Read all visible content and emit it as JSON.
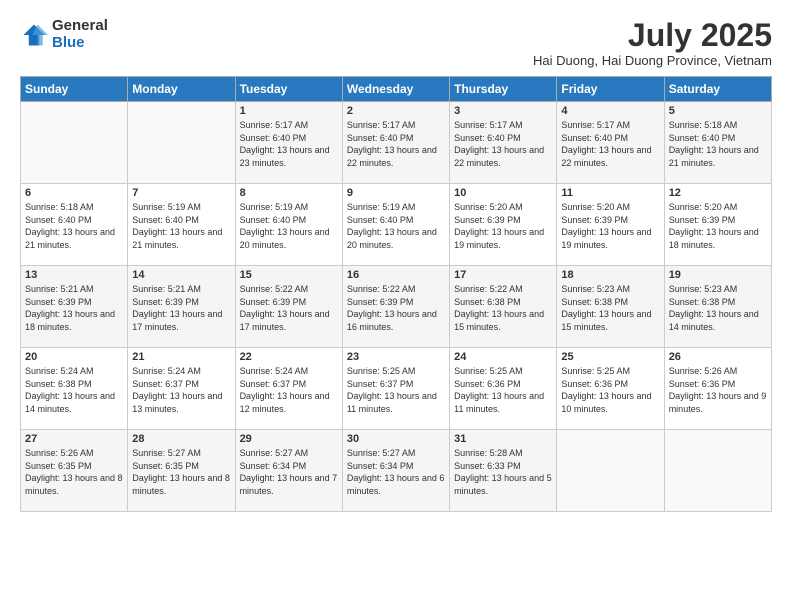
{
  "logo": {
    "general": "General",
    "blue": "Blue"
  },
  "title": {
    "month_year": "July 2025",
    "location": "Hai Duong, Hai Duong Province, Vietnam"
  },
  "days_of_week": [
    "Sunday",
    "Monday",
    "Tuesday",
    "Wednesday",
    "Thursday",
    "Friday",
    "Saturday"
  ],
  "weeks": [
    [
      {
        "day": "",
        "info": ""
      },
      {
        "day": "",
        "info": ""
      },
      {
        "day": "1",
        "info": "Sunrise: 5:17 AM\nSunset: 6:40 PM\nDaylight: 13 hours and 23 minutes."
      },
      {
        "day": "2",
        "info": "Sunrise: 5:17 AM\nSunset: 6:40 PM\nDaylight: 13 hours and 22 minutes."
      },
      {
        "day": "3",
        "info": "Sunrise: 5:17 AM\nSunset: 6:40 PM\nDaylight: 13 hours and 22 minutes."
      },
      {
        "day": "4",
        "info": "Sunrise: 5:17 AM\nSunset: 6:40 PM\nDaylight: 13 hours and 22 minutes."
      },
      {
        "day": "5",
        "info": "Sunrise: 5:18 AM\nSunset: 6:40 PM\nDaylight: 13 hours and 21 minutes."
      }
    ],
    [
      {
        "day": "6",
        "info": "Sunrise: 5:18 AM\nSunset: 6:40 PM\nDaylight: 13 hours and 21 minutes."
      },
      {
        "day": "7",
        "info": "Sunrise: 5:19 AM\nSunset: 6:40 PM\nDaylight: 13 hours and 21 minutes."
      },
      {
        "day": "8",
        "info": "Sunrise: 5:19 AM\nSunset: 6:40 PM\nDaylight: 13 hours and 20 minutes."
      },
      {
        "day": "9",
        "info": "Sunrise: 5:19 AM\nSunset: 6:40 PM\nDaylight: 13 hours and 20 minutes."
      },
      {
        "day": "10",
        "info": "Sunrise: 5:20 AM\nSunset: 6:39 PM\nDaylight: 13 hours and 19 minutes."
      },
      {
        "day": "11",
        "info": "Sunrise: 5:20 AM\nSunset: 6:39 PM\nDaylight: 13 hours and 19 minutes."
      },
      {
        "day": "12",
        "info": "Sunrise: 5:20 AM\nSunset: 6:39 PM\nDaylight: 13 hours and 18 minutes."
      }
    ],
    [
      {
        "day": "13",
        "info": "Sunrise: 5:21 AM\nSunset: 6:39 PM\nDaylight: 13 hours and 18 minutes."
      },
      {
        "day": "14",
        "info": "Sunrise: 5:21 AM\nSunset: 6:39 PM\nDaylight: 13 hours and 17 minutes."
      },
      {
        "day": "15",
        "info": "Sunrise: 5:22 AM\nSunset: 6:39 PM\nDaylight: 13 hours and 17 minutes."
      },
      {
        "day": "16",
        "info": "Sunrise: 5:22 AM\nSunset: 6:39 PM\nDaylight: 13 hours and 16 minutes."
      },
      {
        "day": "17",
        "info": "Sunrise: 5:22 AM\nSunset: 6:38 PM\nDaylight: 13 hours and 15 minutes."
      },
      {
        "day": "18",
        "info": "Sunrise: 5:23 AM\nSunset: 6:38 PM\nDaylight: 13 hours and 15 minutes."
      },
      {
        "day": "19",
        "info": "Sunrise: 5:23 AM\nSunset: 6:38 PM\nDaylight: 13 hours and 14 minutes."
      }
    ],
    [
      {
        "day": "20",
        "info": "Sunrise: 5:24 AM\nSunset: 6:38 PM\nDaylight: 13 hours and 14 minutes."
      },
      {
        "day": "21",
        "info": "Sunrise: 5:24 AM\nSunset: 6:37 PM\nDaylight: 13 hours and 13 minutes."
      },
      {
        "day": "22",
        "info": "Sunrise: 5:24 AM\nSunset: 6:37 PM\nDaylight: 13 hours and 12 minutes."
      },
      {
        "day": "23",
        "info": "Sunrise: 5:25 AM\nSunset: 6:37 PM\nDaylight: 13 hours and 11 minutes."
      },
      {
        "day": "24",
        "info": "Sunrise: 5:25 AM\nSunset: 6:36 PM\nDaylight: 13 hours and 11 minutes."
      },
      {
        "day": "25",
        "info": "Sunrise: 5:25 AM\nSunset: 6:36 PM\nDaylight: 13 hours and 10 minutes."
      },
      {
        "day": "26",
        "info": "Sunrise: 5:26 AM\nSunset: 6:36 PM\nDaylight: 13 hours and 9 minutes."
      }
    ],
    [
      {
        "day": "27",
        "info": "Sunrise: 5:26 AM\nSunset: 6:35 PM\nDaylight: 13 hours and 8 minutes."
      },
      {
        "day": "28",
        "info": "Sunrise: 5:27 AM\nSunset: 6:35 PM\nDaylight: 13 hours and 8 minutes."
      },
      {
        "day": "29",
        "info": "Sunrise: 5:27 AM\nSunset: 6:34 PM\nDaylight: 13 hours and 7 minutes."
      },
      {
        "day": "30",
        "info": "Sunrise: 5:27 AM\nSunset: 6:34 PM\nDaylight: 13 hours and 6 minutes."
      },
      {
        "day": "31",
        "info": "Sunrise: 5:28 AM\nSunset: 6:33 PM\nDaylight: 13 hours and 5 minutes."
      },
      {
        "day": "",
        "info": ""
      },
      {
        "day": "",
        "info": ""
      }
    ]
  ]
}
